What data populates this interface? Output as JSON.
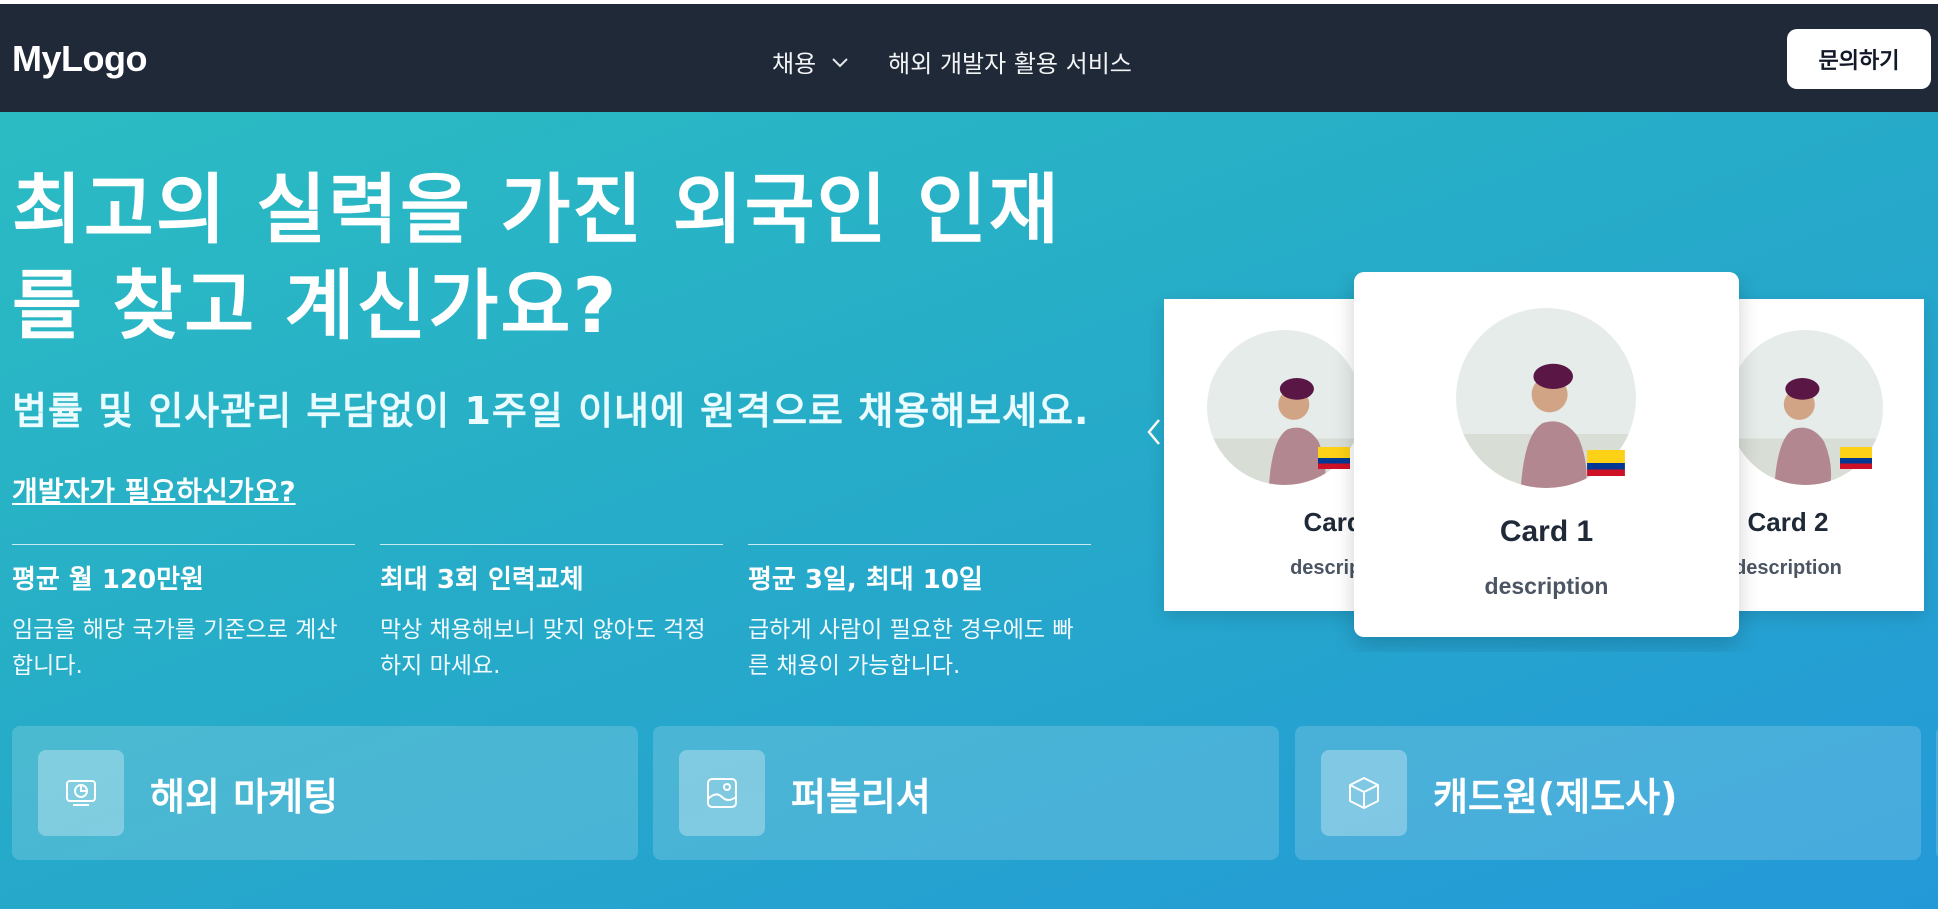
{
  "nav": {
    "logo": "MyLogo",
    "menu": [
      {
        "label": "채용",
        "icon": "chevron-down-icon"
      },
      {
        "label": "해외 개발자 활용 서비스"
      }
    ],
    "contact_label": "문의하기"
  },
  "hero": {
    "title_line1": "최고의 실력을 가진 외국인 인재",
    "title_line2": "를 찾고 계신가요?",
    "subtitle": "법률 및 인사관리 부담없이 1주일 이내에 원격으로 채용해보세요.",
    "link": "개발자가 필요하신가요?",
    "stats": [
      {
        "title": "평균 월 120만원",
        "desc": "임금을 해당 국가를 기준으로 계산합니다."
      },
      {
        "title": "최대 3회 인력교체",
        "desc": "막상 채용해보니 맞지 않아도 걱정하지 마세요."
      },
      {
        "title": "평균 3일, 최대 10일",
        "desc": "급하게 사람이 필요한 경우에도 빠른 채용이 가능합니다."
      }
    ]
  },
  "carousel": {
    "prev_icon": "chevron-left-icon",
    "cards": [
      {
        "title": "Card 5",
        "desc": "description",
        "flag": "colombia-flag-icon"
      },
      {
        "title": "Card 1",
        "desc": "description",
        "flag": "colombia-flag-icon"
      },
      {
        "title": "Card 2",
        "desc": "description",
        "flag": "colombia-flag-icon"
      }
    ]
  },
  "categories": [
    {
      "label": "해외 마케팅",
      "icon": "monitor-chart-icon"
    },
    {
      "label": "퍼블리셔",
      "icon": "image-icon"
    },
    {
      "label": "캐드원(제도사)",
      "icon": "cube-icon"
    }
  ],
  "colors": {
    "navbar": "#1f2937",
    "hero_start": "#2bbcc3",
    "hero_end": "#2499d8",
    "card_title": "#1f2937"
  }
}
